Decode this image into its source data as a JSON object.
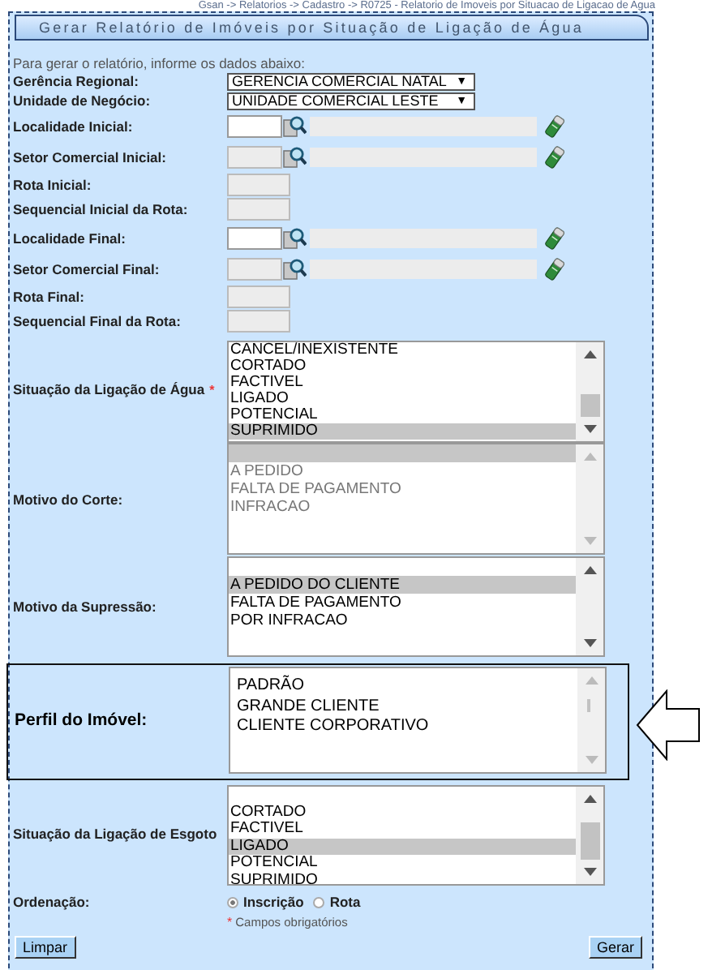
{
  "breadcrumb": "Gsan -> Relatorios -> Cadastro -> R0725 - Relatorio de Imoveis por Situacao de Ligacao de Agua",
  "form": {
    "title": "Gerar Relatório de Imóveis por Situação de Ligação de Água",
    "intro": "Para gerar o relatório, informe os dados abaixo:",
    "fields": [
      {
        "kind": "select",
        "label": "Gerência Regional:",
        "value": "GERENCIA COMERCIAL NATAL",
        "caret": "▼"
      },
      {
        "kind": "select",
        "label": "Unidade de Negócio:",
        "value": "UNIDADE COMERCIAL LESTE",
        "caret": "▼"
      },
      {
        "kind": "lookup",
        "label": "Localidade Inicial:",
        "disabled": false
      },
      {
        "kind": "lookup",
        "label": "Setor Comercial Inicial:",
        "disabled": true
      },
      {
        "kind": "text",
        "label": "Rota Inicial:",
        "disabled": true
      },
      {
        "kind": "text",
        "label": "Sequencial Inicial da Rota:",
        "disabled": true
      },
      {
        "kind": "lookup",
        "label": "Localidade Final:",
        "disabled": false
      },
      {
        "kind": "lookup",
        "label": "Setor Comercial Final:",
        "disabled": true
      },
      {
        "kind": "text",
        "label": "Rota Final:",
        "disabled": true
      },
      {
        "kind": "text",
        "label": "Sequencial Final da Rota:",
        "disabled": true
      },
      {
        "kind": "listbox",
        "label": "Situação da Ligação de Água",
        "required_mark": "*",
        "disabled": false,
        "highlighted": false,
        "options": [
          {
            "label": "CANCEL/INEXISTENTE",
            "selected": false
          },
          {
            "label": "CORTADO",
            "selected": false
          },
          {
            "label": "FACTIVEL",
            "selected": false
          },
          {
            "label": "LIGADO",
            "selected": false
          },
          {
            "label": "POTENCIAL",
            "selected": false
          },
          {
            "label": "SUPRIMIDO",
            "selected": true
          }
        ]
      },
      {
        "kind": "listbox",
        "label": "Motivo do Corte:",
        "disabled": true,
        "highlighted": false,
        "blank_option": {
          "selected": true
        },
        "options": [
          {
            "label": "A PEDIDO",
            "selected": false
          },
          {
            "label": "FALTA DE PAGAMENTO",
            "selected": false
          },
          {
            "label": "INFRACAO",
            "selected": false
          }
        ]
      },
      {
        "kind": "listbox",
        "label": "Motivo da Supressão:",
        "disabled": false,
        "highlighted": false,
        "blank_option": {
          "selected": false
        },
        "options": [
          {
            "label": "A PEDIDO DO CLIENTE",
            "selected": true
          },
          {
            "label": "FALTA DE PAGAMENTO",
            "selected": false
          },
          {
            "label": "POR INFRACAO",
            "selected": false
          }
        ]
      },
      {
        "kind": "listbox",
        "label": "Perfil do Imóvel:",
        "disabled": false,
        "highlighted": true,
        "options": [
          {
            "label": "PADRÃO",
            "selected": false
          },
          {
            "label": "GRANDE CLIENTE",
            "selected": false
          },
          {
            "label": "CLIENTE CORPORATIVO",
            "selected": false
          }
        ]
      },
      {
        "kind": "listbox",
        "label": "Situação da Ligação de Esgoto",
        "disabled": false,
        "highlighted": false,
        "blank_option": {
          "selected": false
        },
        "options": [
          {
            "label": "CORTADO",
            "selected": false
          },
          {
            "label": "FACTIVEL",
            "selected": false
          },
          {
            "label": "LIGADO",
            "selected": true
          },
          {
            "label": "POTENCIAL",
            "selected": false
          },
          {
            "label": "SUPRIMIDO",
            "selected": false
          }
        ]
      }
    ],
    "ordering": {
      "label": "Ordenação:",
      "options": [
        {
          "label": "Inscrição",
          "selected": true
        },
        {
          "label": "Rota",
          "selected": false
        }
      ]
    },
    "required_note": {
      "mark": "*",
      "text": "Campos obrigatórios"
    },
    "buttons": [
      {
        "kind": "clear",
        "label": "Limpar"
      },
      {
        "kind": "submit",
        "label": "Gerar"
      }
    ]
  }
}
